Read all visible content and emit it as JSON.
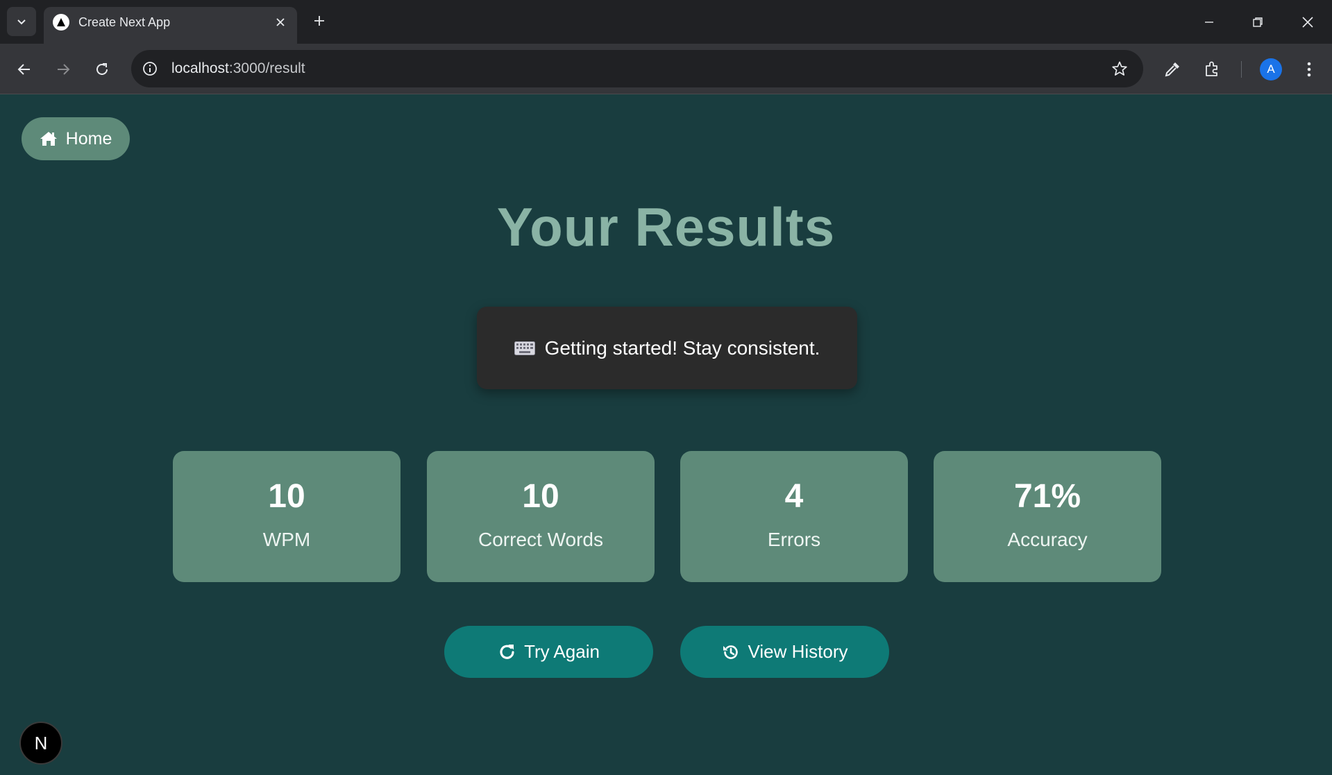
{
  "browser": {
    "tab_title": "Create Next App",
    "url_host": "localhost",
    "url_path": ":3000/result",
    "profile_initial": "A"
  },
  "page": {
    "home_label": "Home",
    "title": "Your Results",
    "message": "Getting started! Stay consistent.",
    "stats": [
      {
        "value": "10",
        "label": "WPM"
      },
      {
        "value": "10",
        "label": "Correct Words"
      },
      {
        "value": "4",
        "label": "Errors"
      },
      {
        "value": "71%",
        "label": "Accuracy"
      }
    ],
    "try_again_label": "Try Again",
    "view_history_label": "View History",
    "next_badge_label": "N"
  },
  "colors": {
    "background": "#193d3f",
    "card": "#5e8a79",
    "title": "#8ab3a5",
    "action_button": "#0e7a76",
    "message_card": "#2b2b2b"
  },
  "icons": {
    "home": "home-icon",
    "message": "keyboard-icon",
    "try_again": "redo-icon",
    "view_history": "history-icon"
  }
}
